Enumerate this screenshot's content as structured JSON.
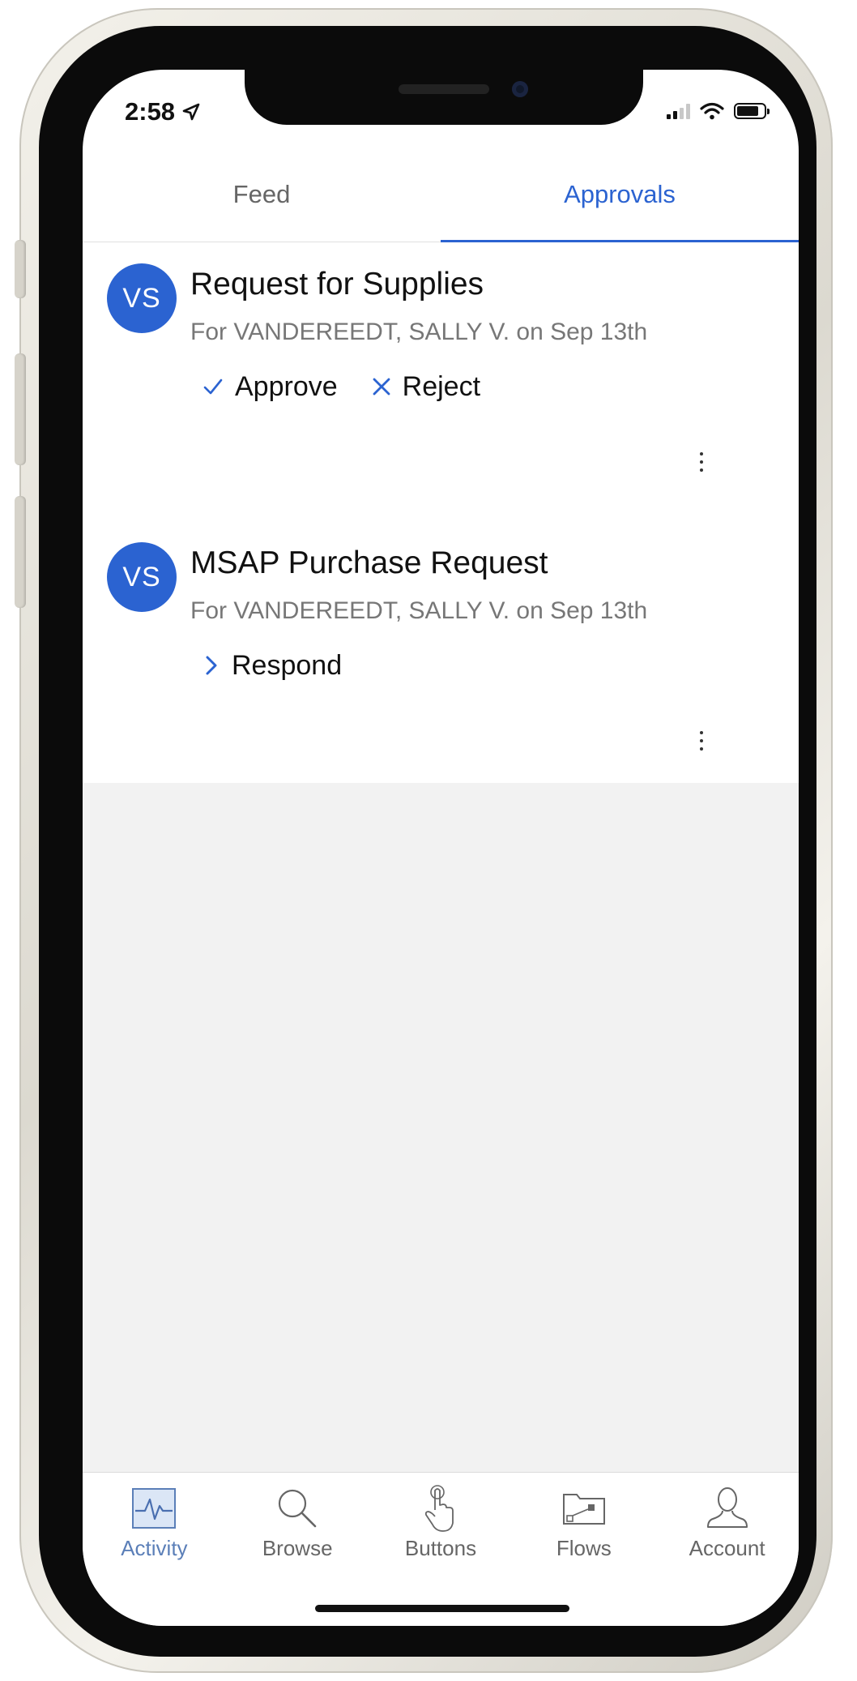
{
  "status_bar": {
    "time": "2:58"
  },
  "tabs": [
    {
      "label": "Feed",
      "active": false
    },
    {
      "label": "Approvals",
      "active": true
    }
  ],
  "requests": [
    {
      "avatar": "VS",
      "title": "Request for Supplies",
      "subtitle": "For VANDEREEDT, SALLY V. on Sep 13th",
      "actions": [
        {
          "icon": "check-icon",
          "label": "Approve"
        },
        {
          "icon": "close-icon",
          "label": "Reject"
        }
      ]
    },
    {
      "avatar": "VS",
      "title": "MSAP Purchase Request",
      "subtitle": "For VANDEREEDT, SALLY V. on Sep 13th",
      "actions": [
        {
          "icon": "chevron-right-icon",
          "label": "Respond"
        }
      ]
    }
  ],
  "bottom_nav": [
    {
      "icon": "activity-icon",
      "label": "Activity",
      "active": true
    },
    {
      "icon": "search-icon",
      "label": "Browse",
      "active": false
    },
    {
      "icon": "tap-icon",
      "label": "Buttons",
      "active": false
    },
    {
      "icon": "flows-folder-icon",
      "label": "Flows",
      "active": false
    },
    {
      "icon": "account-icon",
      "label": "Account",
      "active": false
    }
  ],
  "colors": {
    "accent": "#2b63d1",
    "avatar_bg": "#2b63d1",
    "empty_bg": "#f2f2f2"
  }
}
